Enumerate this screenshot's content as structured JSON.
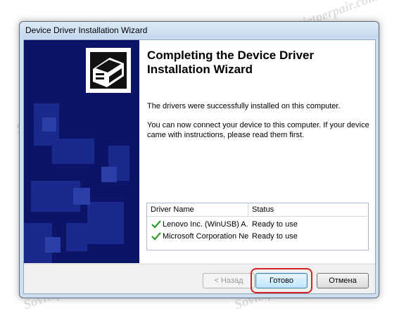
{
  "window": {
    "title": "Device Driver Installation Wizard"
  },
  "content": {
    "heading": "Completing the Device Driver Installation Wizard",
    "success_text": "The drivers were successfully installed on this computer.",
    "instructions_text": "You can now connect your device to this computer. If your device came with instructions, please read them first."
  },
  "driver_list": {
    "columns": [
      "Driver Name",
      "Status"
    ],
    "rows": [
      {
        "name": "Lenovo Inc. (WinUSB) A...",
        "status": "Ready to use"
      },
      {
        "name": "Microsoft Corporation Ne...",
        "status": "Ready to use"
      }
    ]
  },
  "buttons": {
    "back": "< Назад",
    "finish": "Готово",
    "cancel": "Отмена"
  },
  "watermark": "Sovietperpair.com",
  "colors": {
    "sidebar": "#0b1466",
    "check": "#2e9b2e",
    "highlight": "#d42323"
  }
}
